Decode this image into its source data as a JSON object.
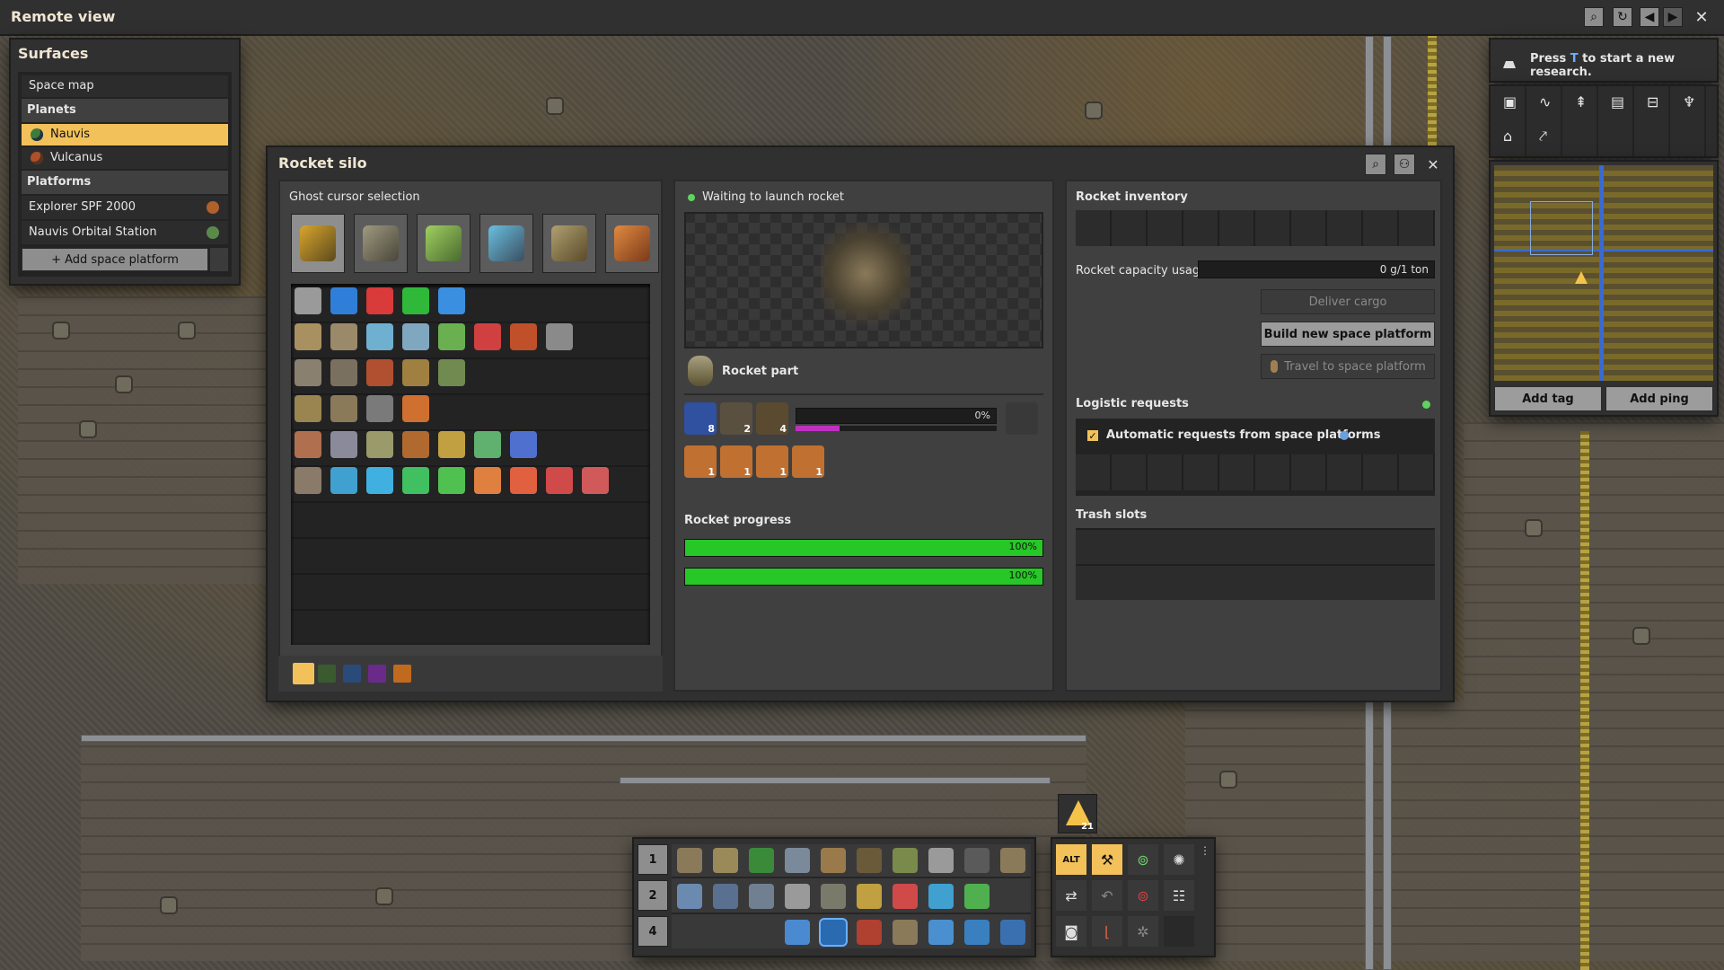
{
  "window_title": "Remote view",
  "surfaces": {
    "title": "Surfaces",
    "space_map": "Space map",
    "planets_header": "Planets",
    "planets": [
      {
        "label": "Nauvis",
        "color": "#3e7a3a"
      },
      {
        "label": "Vulcanus",
        "color": "#b0502a"
      }
    ],
    "platforms_header": "Platforms",
    "platforms": [
      {
        "label": "Explorer SPF 2000"
      },
      {
        "label": "Nauvis Orbital Station"
      }
    ],
    "add_platform": "+ Add space platform"
  },
  "silo": {
    "title": "Rocket silo",
    "ghost_title": "Ghost cursor selection",
    "status": "Waiting to launch rocket",
    "recipe": "Rocket part",
    "craft_progress": "0%",
    "ingredient_counts": [
      "8",
      "2",
      "4"
    ],
    "output_counts": [
      "1",
      "1",
      "1",
      "1"
    ],
    "rocket_progress_title": "Rocket progress",
    "rocket_progress": [
      {
        "pct": 1.0,
        "label": "100%"
      },
      {
        "pct": 1.0,
        "label": "100%"
      }
    ],
    "inventory_title": "Rocket inventory",
    "capacity_label": "Rocket capacity usage",
    "capacity_value": "0 g/1 ton",
    "deliver_cargo": "Deliver cargo",
    "build_platform": "Build new space platform",
    "travel_platform": "Travel to space platform",
    "logistic_title": "Logistic requests",
    "auto_requests": "Automatic requests from space platforms",
    "trash_title": "Trash slots"
  },
  "research": {
    "prefix": "Press ",
    "key": "T",
    "suffix": " to start a new research."
  },
  "minimap": {
    "add_tag": "Add tag",
    "add_ping": "Add ping"
  },
  "hotbar": {
    "rows": [
      "1",
      "2",
      "4"
    ],
    "alert_count": "21"
  },
  "colors": {
    "accent": "#f5c34a",
    "green": "#27c727",
    "bar": "#27c727"
  }
}
